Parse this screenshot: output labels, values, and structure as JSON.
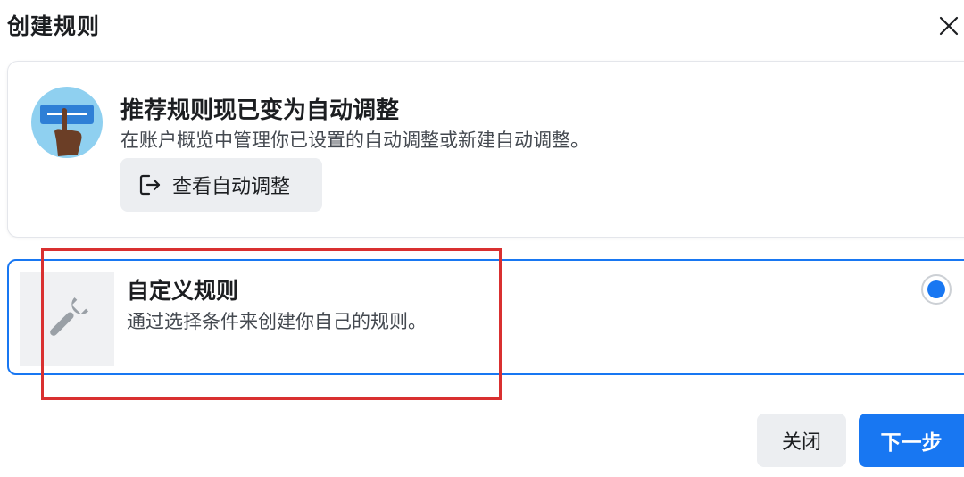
{
  "dialog": {
    "title": "创建规则",
    "close_icon": "close-icon"
  },
  "recommendation": {
    "title": "推荐规则现已变为自动调整",
    "description": "在账户概览中管理你已设置的自动调整或新建自动调整。",
    "button_label": "查看自动调整",
    "button_icon": "exit-arrow-icon",
    "illustration_icon": "hand-tap-illustration-icon"
  },
  "custom_rule": {
    "title": "自定义规则",
    "description": "通过选择条件来创建你自己的规则。",
    "icon": "wrench-icon",
    "selected": true
  },
  "footer": {
    "close_label": "关闭",
    "next_label": "下一步"
  },
  "colors": {
    "accent": "#1877f2",
    "highlight": "#d93030",
    "secondary_button": "#eceef1"
  }
}
